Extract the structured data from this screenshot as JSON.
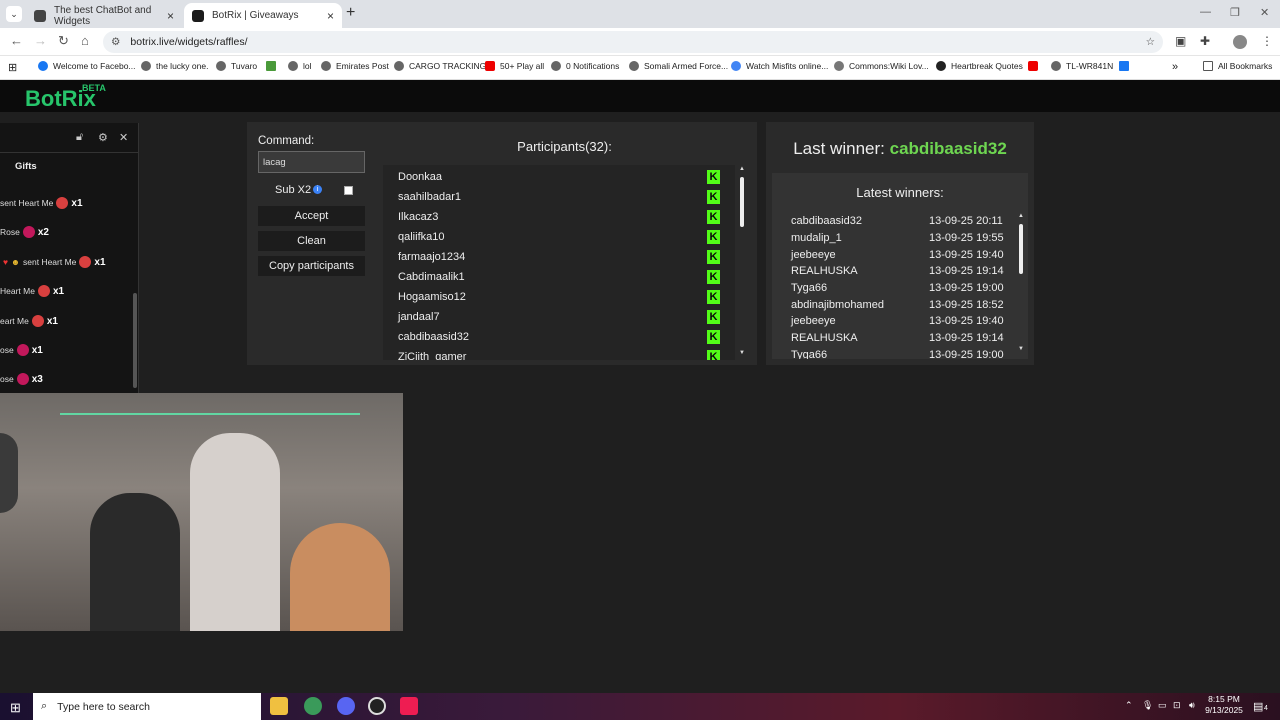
{
  "browser": {
    "tabs": [
      {
        "title": "The best ChatBot and Widgets",
        "active": false
      },
      {
        "title": "BotRix | Giveaways",
        "active": true
      }
    ],
    "url": "botrix.live/widgets/raffles/",
    "bookmarks": [
      "Welcome to Facebo...",
      "the lucky one.",
      "Tuvaro",
      "",
      "lol",
      "Emirates Post",
      "CARGO TRACKING",
      "50+ Play all",
      "0 Notifications",
      "Somali Armed Force...",
      "Watch Misfits online...",
      "Commons:Wiki Lov...",
      "Heartbreak Quotes",
      "",
      "TL-WR841N",
      ""
    ],
    "all_bookmarks": "All Bookmarks"
  },
  "site": {
    "logo": "BotRix",
    "badge": "BETA"
  },
  "chat_overlay": {
    "tab_label": "Gifts",
    "lines": [
      {
        "text": "sent Heart Me",
        "count": "x1"
      },
      {
        "text": "Rose",
        "count": "x2"
      },
      {
        "text": "sent Heart Me",
        "count": "x1"
      },
      {
        "text": "Heart Me",
        "count": "x1"
      },
      {
        "text": "eart Me",
        "count": "x1"
      },
      {
        "text": "ose",
        "count": "x1"
      },
      {
        "text": "ose",
        "count": "x3"
      }
    ]
  },
  "raffle": {
    "command_label": "Command:",
    "command_value": "lacag",
    "sub_label": "Sub X2",
    "sub_checked": false,
    "accept_label": "Accept",
    "clean_label": "Clean",
    "copy_label": "Copy participants",
    "participants_title": "Participants(32):",
    "participants": [
      "Doonkaa",
      "saahilbadar1",
      "Ilkacaz3",
      "qaliifka10",
      "farmaajo1234",
      "Cabdimaalik1",
      "Hogaamiso12",
      "jandaal7",
      "cabdibaasid32",
      "ZiCiith_gamer"
    ]
  },
  "winners": {
    "last_winner_label": "Last winner:",
    "last_winner_name": "cabdibaasid32",
    "latest_title": "Latest winners:",
    "rows": [
      {
        "name": "cabdibaasid32",
        "date": "13-09-25 20:11"
      },
      {
        "name": "mudalip_1",
        "date": "13-09-25 19:55"
      },
      {
        "name": "jeebeeye",
        "date": "13-09-25 19:40"
      },
      {
        "name": "REALHUSKA",
        "date": "13-09-25 19:14"
      },
      {
        "name": "Tyga66",
        "date": "13-09-25 19:00"
      },
      {
        "name": "abdinajibmohamed",
        "date": "13-09-25 18:52"
      },
      {
        "name": "jeebeeye",
        "date": "13-09-25 19:40"
      },
      {
        "name": "REALHUSKA",
        "date": "13-09-25 19:14"
      },
      {
        "name": "Tyga66",
        "date": "13-09-25 19:00"
      }
    ]
  },
  "taskbar": {
    "search_placeholder": "Type here to search",
    "time": "8:15 PM",
    "date": "9/13/2025",
    "notif_count": "4"
  }
}
